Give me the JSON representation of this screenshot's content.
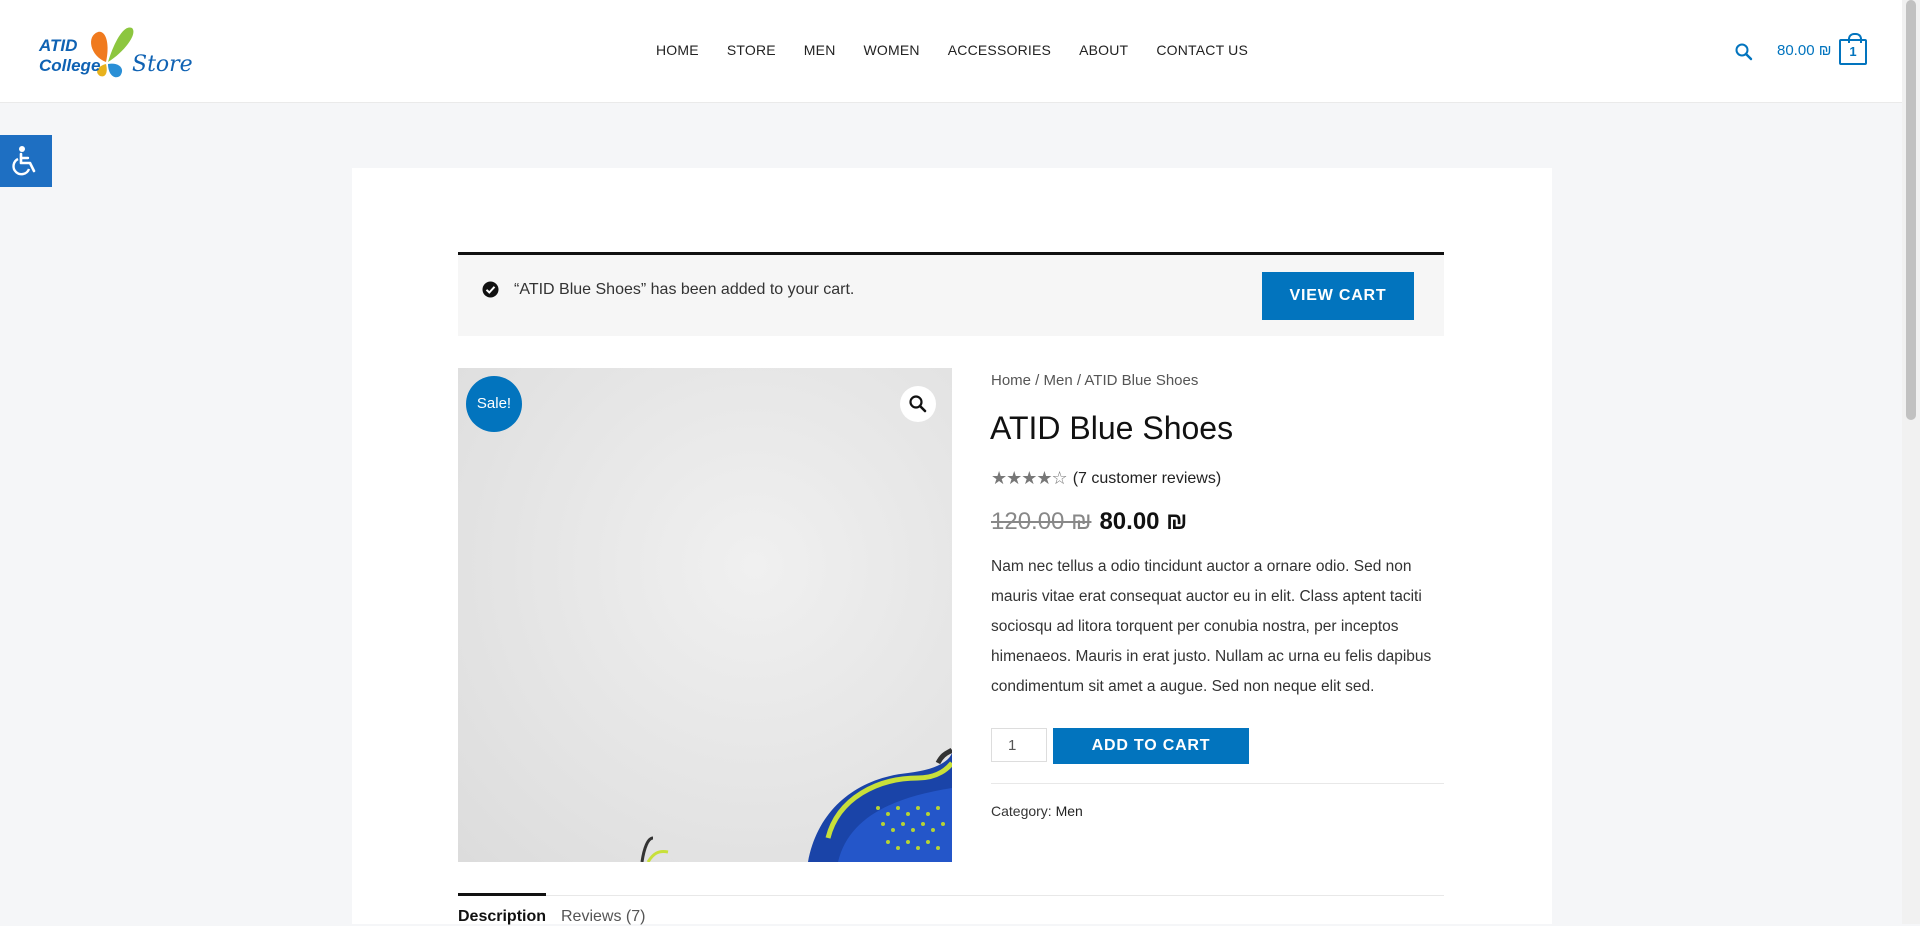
{
  "logo": {
    "line1": "ATID",
    "line2": "College",
    "word": "Store"
  },
  "nav": [
    "HOME",
    "STORE",
    "MEN",
    "WOMEN",
    "ACCESSORIES",
    "ABOUT",
    "CONTACT US"
  ],
  "header": {
    "cart_total": "80.00 ₪",
    "cart_count": "1"
  },
  "notice": {
    "text": "“ATID Blue Shoes” has been added to your cart.",
    "button": "VIEW CART"
  },
  "product": {
    "sale_badge": "Sale!",
    "breadcrumb": {
      "home": "Home",
      "sep1": " / ",
      "men": "Men",
      "sep2": " / ",
      "current": "ATID Blue Shoes"
    },
    "title": "ATID Blue Shoes",
    "rating": {
      "stars": 4,
      "out_of": 5,
      "reviews_label": "(7 customer reviews)"
    },
    "price_old": "120.00 ₪",
    "price_new": "80.00 ₪",
    "description": "Nam nec tellus a odio tincidunt auctor a ornare odio. Sed non mauris vitae erat consequat auctor eu in elit. Class aptent taciti sociosqu ad litora torquent per conubia nostra, per inceptos himenaeos. Mauris in erat justo. Nullam ac urna eu felis dapibus condimentum sit amet a augue. Sed non neque elit sed.",
    "quantity": "1",
    "add_to_cart": "ADD TO CART",
    "category_label": "Category:",
    "category_value": "Men"
  },
  "tabs": [
    {
      "label": "Description"
    },
    {
      "label": "Reviews (7)"
    }
  ],
  "colors": {
    "accent": "#0274be",
    "accessibility": "#1e6fc2"
  }
}
